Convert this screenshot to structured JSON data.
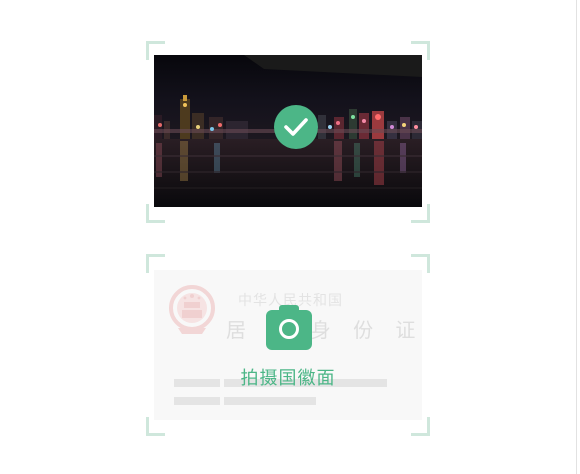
{
  "front_card": {
    "status": "captured",
    "check_icon": "check-circle-icon"
  },
  "back_card": {
    "title_line1": "中华人民共和国",
    "title_line2": "居 民 身 份 证",
    "camera_icon": "camera-icon",
    "caption": "拍摄国徽面"
  },
  "colors": {
    "accent": "#4cb687",
    "frame_corner": "#cfe7dc"
  }
}
